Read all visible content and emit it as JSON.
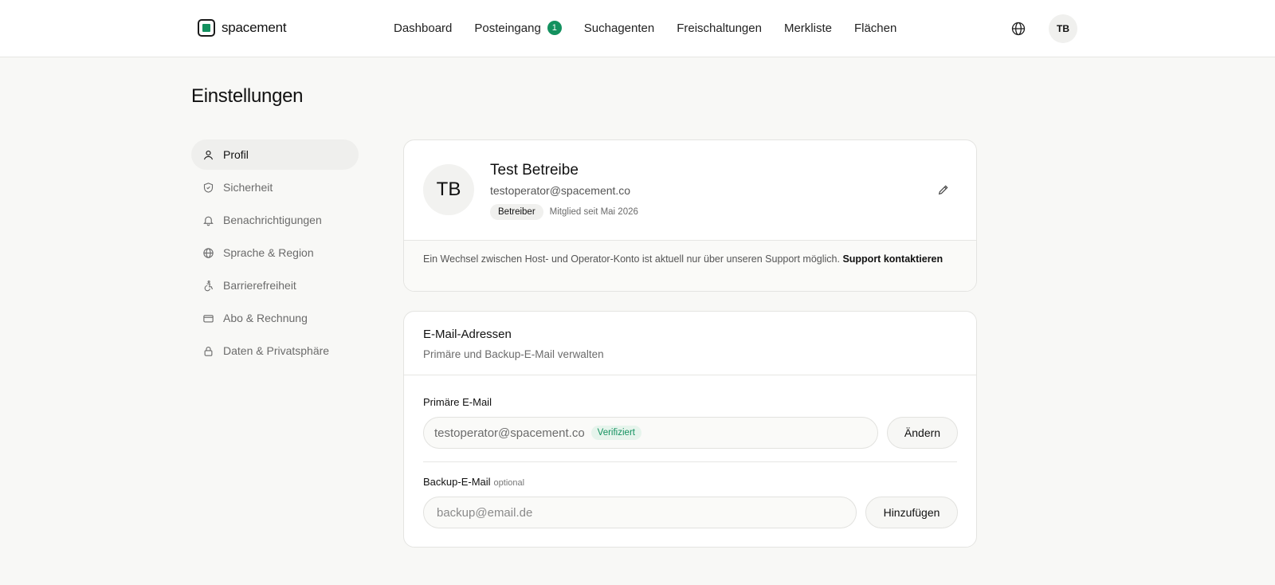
{
  "header": {
    "logo_text": "spacement",
    "nav": [
      {
        "label": "Dashboard"
      },
      {
        "label": "Posteingang",
        "badge": "1"
      },
      {
        "label": "Suchagenten"
      },
      {
        "label": "Freischaltungen"
      },
      {
        "label": "Merkliste"
      },
      {
        "label": "Flächen"
      }
    ],
    "avatar_initials": "TB",
    "icons": {
      "language": "globe-icon"
    }
  },
  "page": {
    "title": "Einstellungen"
  },
  "sidebar": {
    "items": [
      {
        "label": "Profil",
        "icon": "user-icon",
        "active": true
      },
      {
        "label": "Sicherheit",
        "icon": "shield-icon"
      },
      {
        "label": "Benachrichtigungen",
        "icon": "bell-icon"
      },
      {
        "label": "Sprache & Region",
        "icon": "globe-icon"
      },
      {
        "label": "Barrierefreiheit",
        "icon": "accessibility-icon"
      },
      {
        "label": "Abo & Rechnung",
        "icon": "credit-card-icon"
      },
      {
        "label": "Daten & Privatsphäre",
        "icon": "lock-icon"
      }
    ]
  },
  "profile": {
    "initials": "TB",
    "name": "Test Betreibe",
    "email": "testoperator@spacement.co",
    "role": "Betreiber",
    "member_since": "Mitglied seit Mai 2026",
    "note": "Ein Wechsel zwischen Host- und Operator-Konto ist aktuell nur über unseren Support möglich.",
    "support_link": "Support kontaktieren"
  },
  "emails": {
    "title": "E-Mail-Adressen",
    "subtitle": "Primäre und Backup-E-Mail verwalten",
    "primary": {
      "label": "Primäre E-Mail",
      "value": "testoperator@spacement.co",
      "status": "Verifiziert",
      "button": "Ändern"
    },
    "backup": {
      "label": "Backup-E-Mail",
      "optional": "optional",
      "placeholder": "backup@email.de",
      "button": "Hinzufügen"
    }
  },
  "colors": {
    "accent": "#13915f",
    "background": "#f8f8f6",
    "surface": "#ffffff"
  }
}
